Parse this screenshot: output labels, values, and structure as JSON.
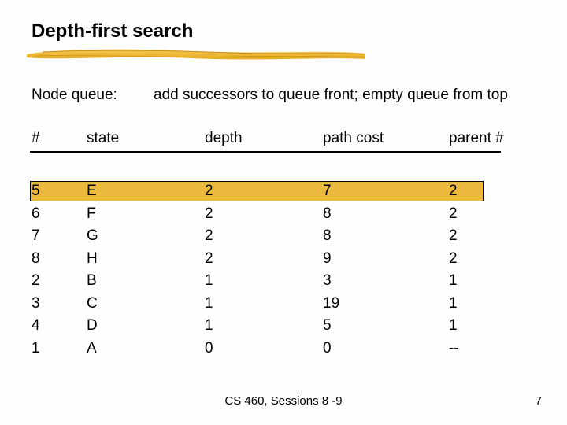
{
  "title": "Depth-first search",
  "queue_label": "Node queue:",
  "queue_add": "add successors to queue front; empty queue from top",
  "headers": {
    "num": "#",
    "state": "state",
    "depth": "depth",
    "cost": "path cost",
    "parent": "parent #"
  },
  "rows": [
    {
      "num": "5",
      "state": "E",
      "depth": "2",
      "cost": "7",
      "parent": "2",
      "highlight": true
    },
    {
      "num": "6",
      "state": "F",
      "depth": "2",
      "cost": "8",
      "parent": "2"
    },
    {
      "num": "7",
      "state": "G",
      "depth": "2",
      "cost": "8",
      "parent": "2"
    },
    {
      "num": "8",
      "state": "H",
      "depth": "2",
      "cost": "9",
      "parent": "2"
    },
    {
      "num": "2",
      "state": "B",
      "depth": "1",
      "cost": "3",
      "parent": "1"
    },
    {
      "num": "3",
      "state": "C",
      "depth": "1",
      "cost": "19",
      "parent": "1"
    },
    {
      "num": "4",
      "state": "D",
      "depth": "1",
      "cost": "5",
      "parent": "1"
    },
    {
      "num": "1",
      "state": "A",
      "depth": "0",
      "cost": "0",
      "parent": "--"
    }
  ],
  "footer": "CS 460, Sessions 8 -9",
  "page_number": "7",
  "chart_data": {
    "type": "table",
    "title": "Depth-first search node queue",
    "columns": [
      "#",
      "state",
      "depth",
      "path cost",
      "parent #"
    ],
    "rows": [
      [
        "5",
        "E",
        2,
        7,
        "2"
      ],
      [
        "6",
        "F",
        2,
        8,
        "2"
      ],
      [
        "7",
        "G",
        2,
        8,
        "2"
      ],
      [
        "8",
        "H",
        2,
        9,
        "2"
      ],
      [
        "2",
        "B",
        1,
        3,
        "1"
      ],
      [
        "3",
        "C",
        1,
        19,
        "1"
      ],
      [
        "4",
        "D",
        1,
        5,
        "1"
      ],
      [
        "1",
        "A",
        0,
        0,
        "--"
      ]
    ],
    "highlighted_row_index": 0
  }
}
